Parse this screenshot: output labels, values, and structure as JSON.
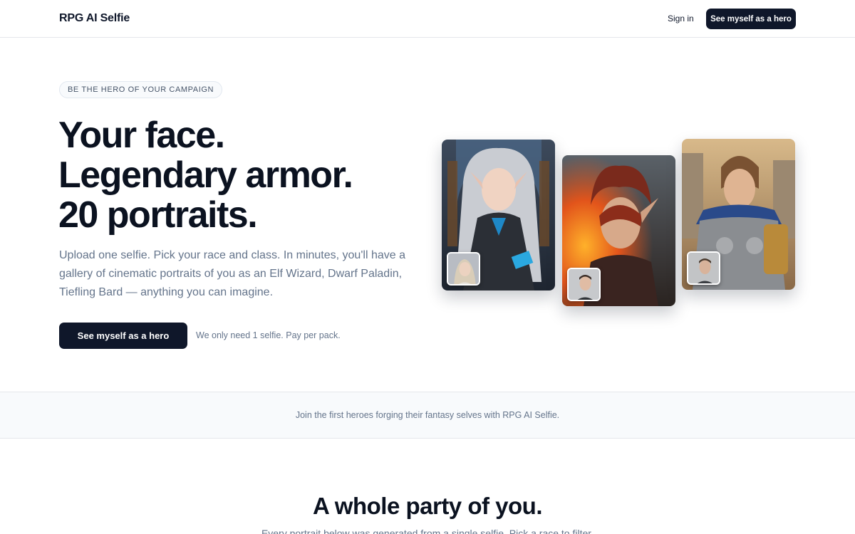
{
  "header": {
    "brand": "RPG AI Selfie",
    "signin_label": "Sign in",
    "cta_label": "See myself as a hero"
  },
  "hero": {
    "eyebrow": "BE THE HERO OF YOUR CAMPAIGN",
    "headline": [
      "Your face.",
      "Legendary armor.",
      "20 portraits."
    ],
    "lede": "Upload one selfie. Pick your race and class. In minutes, you'll have a gallery of cinematic portraits of you as an Elf Wizard, Dwarf Paladin, Tiefling Bard — anything you can imagine.",
    "cta_label": "See myself as a hero",
    "note": "We only need 1 selfie. Pay per pack."
  },
  "showcase": {
    "cards": [
      {
        "subject": "elf-wizard-portrait",
        "thumb": "selfie-thumbnail-woman"
      },
      {
        "subject": "dragonborn-fire-portrait",
        "thumb": "selfie-thumbnail-man"
      },
      {
        "subject": "paladin-knight-portrait",
        "thumb": "selfie-thumbnail-man-2"
      }
    ]
  },
  "social_proof": {
    "text": "Join the first heroes forging their fantasy selves with RPG AI Selfie."
  },
  "section": {
    "title": "A whole party of you.",
    "subtitle": "Every portrait below was generated from a single selfie. Pick a race to filter."
  },
  "colors": {
    "primary": "#0f172a",
    "muted": "#64748b",
    "border": "#e5e7eb",
    "band_bg": "#f8fafc"
  }
}
